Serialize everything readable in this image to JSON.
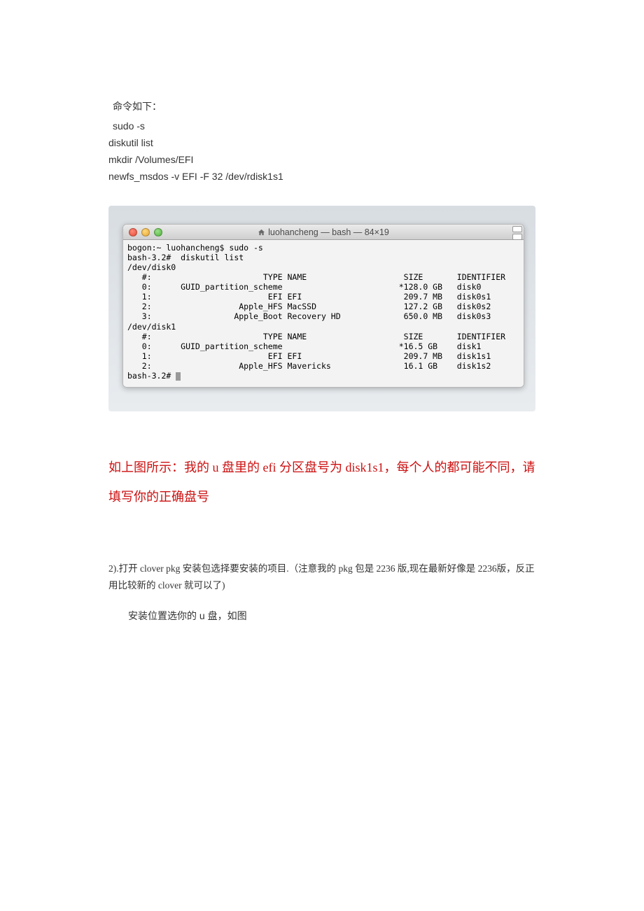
{
  "doc": {
    "intro": "命令如下：",
    "cmds": [
      "sudo -s",
      "diskutil list",
      "mkdir /Volumes/EFI",
      "newfs_msdos -v EFI -F 32 /dev/rdisk1s1"
    ],
    "red_note": "如上图所示：我的 u 盘里的 efi 分区盘号为 disk1s1，每个人的都可能不同，请填写你的正确盘号",
    "para2": "2).打开 clover pkg 安装包选择要安装的项目.（注意我的 pkg 包是 2236 版,现在最新好像是 2236版，反正用比较新的 clover 就可以了)",
    "para3": "安装位置选你的 u 盘，如图"
  },
  "terminal": {
    "title": "luohancheng — bash — 84×19",
    "lines": {
      "l1": "bogon:~ luohancheng$ sudo -s",
      "l2": "bash-3.2#  diskutil list",
      "l3": "/dev/disk0",
      "l4": "   #:                       TYPE NAME                    SIZE       IDENTIFIER",
      "l5": "   0:      GUID_partition_scheme                        *128.0 GB   disk0",
      "l6": "   1:                        EFI EFI                     209.7 MB   disk0s1",
      "l7": "   2:                  Apple_HFS MacSSD                  127.2 GB   disk0s2",
      "l8": "   3:                 Apple_Boot Recovery HD             650.0 MB   disk0s3",
      "l9": "/dev/disk1",
      "l10": "   #:                       TYPE NAME                    SIZE       IDENTIFIER",
      "l11": "   0:      GUID_partition_scheme                        *16.5 GB    disk1",
      "l12": "   1:                        EFI EFI                     209.7 MB   disk1s1",
      "l13": "   2:                  Apple_HFS Mavericks               16.1 GB    disk1s2",
      "l14": "bash-3.2# "
    }
  }
}
